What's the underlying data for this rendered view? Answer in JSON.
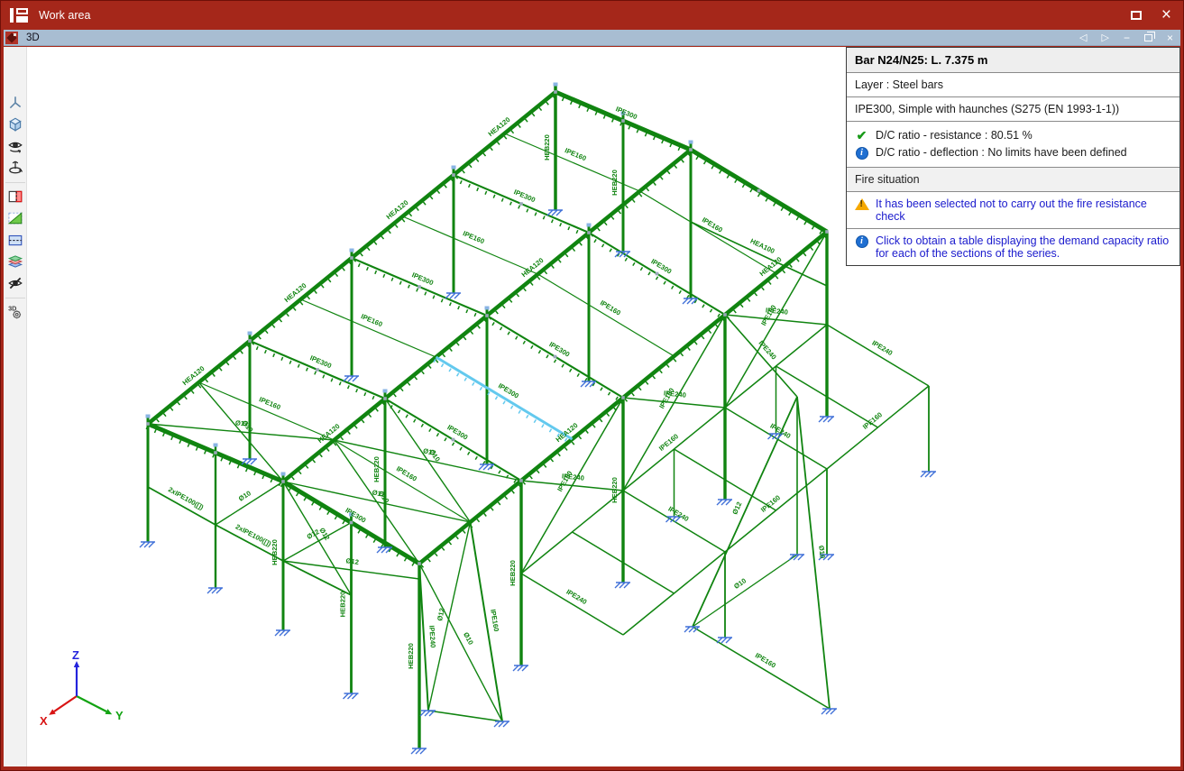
{
  "window": {
    "title": "Work area",
    "controls": {
      "maximize": "maximize",
      "close": "×"
    }
  },
  "tab_bar": {
    "title": "3D",
    "controls": {
      "back": "◁",
      "forward": "▷",
      "minimize": "−",
      "restore": "restore",
      "close": "×"
    }
  },
  "toolbar": {
    "icons": [
      {
        "name": "axes-icon"
      },
      {
        "name": "cube-icon"
      },
      {
        "name": "orbit-view-icon"
      },
      {
        "name": "rotate-view-icon"
      },
      {
        "name": "section-plane-icon"
      },
      {
        "name": "split-view-icon"
      },
      {
        "name": "window-zoom-icon"
      },
      {
        "name": "layers-icon"
      },
      {
        "name": "hide-elements-icon"
      },
      {
        "name": "3d-settings-icon"
      }
    ]
  },
  "panel": {
    "header": "Bar N24/N25: L. 7.375 m",
    "layer": "Layer : Steel bars",
    "section": "IPE300, Simple with haunches (S275 (EN 1993-1-1))",
    "checks": [
      {
        "icon": "check",
        "text": "D/C ratio - resistance : 80.51 %"
      },
      {
        "icon": "info",
        "text": "D/C ratio - deflection : No limits have been defined"
      }
    ],
    "fire_header": "Fire situation",
    "fire_warning": "It has been selected not to carry out the fire resistance check",
    "note": "Click to obtain a table displaying the demand capacity ratio for each of the sections of the series."
  },
  "axes": {
    "x": "X",
    "y": "Y",
    "z": "Z",
    "colors": {
      "x": "#d81414",
      "y": "#12a312",
      "z": "#2424dd"
    }
  },
  "structure": {
    "labels": {
      "rafter": "IPE300",
      "purlin": "IPE160",
      "eave": "HEA120",
      "girt240": "IPE240",
      "girt100": "HEA100",
      "column": "HEB220",
      "rod12": "Ø12",
      "rod10": "Ø10",
      "chord": "2xIPE100([])"
    },
    "colors": {
      "member": "#108410",
      "selected": "#63c9ee",
      "support": "#4070d8",
      "node": "#9aa8b8",
      "cap": "#8ab4e4"
    }
  }
}
